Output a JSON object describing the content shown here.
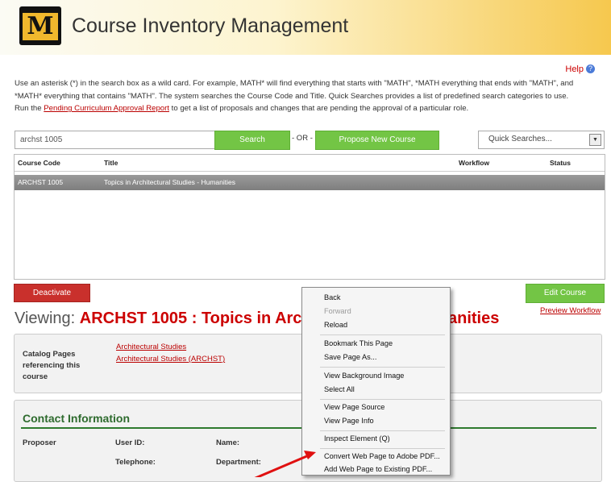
{
  "app": {
    "title": "Course Inventory Management",
    "logo_letter": "M"
  },
  "help": {
    "label": "Help",
    "icon": "help-icon"
  },
  "instructions": {
    "line1": "Use an asterisk (*) in the search box as a wild card. For example, MATH* will find everything that starts with \"MATH\", *MATH everything that ends with \"MATH\", and",
    "line2": "*MATH* everything that contains \"MATH\". The system searches the Course Code and Title. Quick Searches provides a list of predefined search categories to use.",
    "line3_pre": "Run the ",
    "line3_link": "Pending Curriculum Approval Report",
    "line3_post": " to get a list of proposals and changes that are pending the approval of a particular role."
  },
  "search": {
    "value": "archst 1005",
    "button": "Search",
    "or_label": "- OR -",
    "propose_button": "Propose New Course",
    "quick_label": "Quick Searches..."
  },
  "table": {
    "headers": {
      "code": "Course Code",
      "title": "Title",
      "workflow": "Workflow",
      "status": "Status"
    },
    "rows": [
      {
        "code": "ARCHST 1005",
        "title": "Topics in Architectural Studies - Humanities"
      }
    ]
  },
  "actions": {
    "deactivate": "Deactivate",
    "edit": "Edit Course",
    "preview": "Preview Workflow"
  },
  "viewing": {
    "prefix": "Viewing:",
    "course_visible": "ARCHST 1005 : Topics in Archite",
    "course_tail": "anities"
  },
  "catalog": {
    "label": "Catalog Pages referencing this course",
    "links": [
      "Architectural Studies",
      "Architectural Studies (ARCHST)"
    ]
  },
  "contact": {
    "title": "Contact Information",
    "proposer": "Proposer",
    "user_id": "User ID:",
    "name": "Name:",
    "telephone": "Telephone:",
    "department": "Department:"
  },
  "context_menu": {
    "items": [
      "Back",
      "Forward",
      "Reload",
      "Bookmark This Page",
      "Save Page As...",
      "View Background Image",
      "Select All",
      "View Page Source",
      "View Page Info",
      "Inspect Element (Q)",
      "Convert Web Page to Adobe PDF...",
      "Add Web Page to Existing PDF..."
    ],
    "disabled": [
      "Forward"
    ]
  },
  "colors": {
    "accent_green": "#73c545",
    "danger_red": "#c9302c",
    "title_red": "#cc0000",
    "header_gold": "#f6c84e"
  }
}
